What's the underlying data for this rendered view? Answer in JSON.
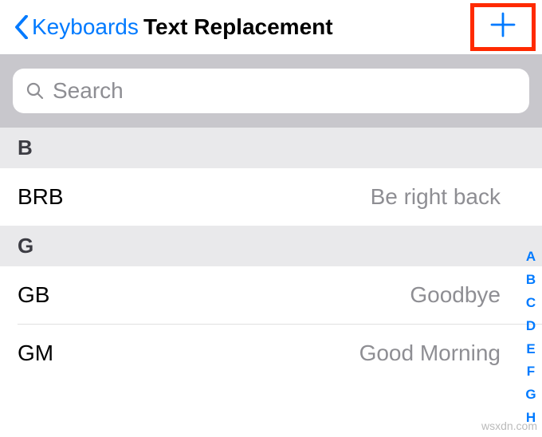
{
  "nav": {
    "back_label": "Keyboards",
    "title": "Text Replacement",
    "add_symbol": "＋"
  },
  "search": {
    "placeholder": "Search"
  },
  "sections": [
    {
      "letter": "B",
      "rows": [
        {
          "shortcut": "BRB",
          "phrase": "Be right back"
        }
      ]
    },
    {
      "letter": "G",
      "rows": [
        {
          "shortcut": "GB",
          "phrase": "Goodbye"
        },
        {
          "shortcut": "GM",
          "phrase": "Good Morning"
        }
      ]
    }
  ],
  "index_letters": [
    "A",
    "B",
    "C",
    "D",
    "E",
    "F",
    "G",
    "H"
  ],
  "watermark": "wsxdn.com"
}
